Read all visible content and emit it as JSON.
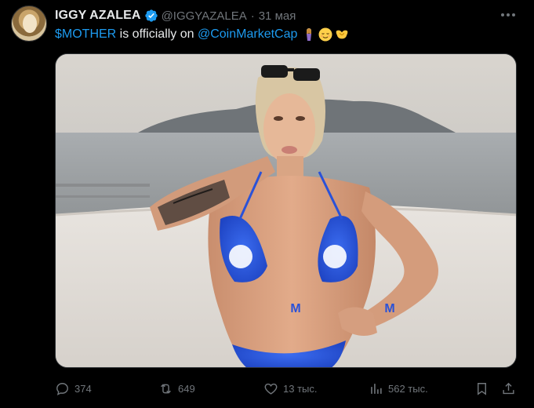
{
  "tweet": {
    "author_name": "IGGY AZALEA",
    "handle": "@IGGYAZALEA",
    "separator": "·",
    "date": "31 мая",
    "text": {
      "cashtag": "$MOTHER",
      "middle": " is officially on ",
      "mention": "@CoinMarketCap"
    },
    "emojis": [
      "woman-icon",
      "relieved-face-icon",
      "heart-hands-icon"
    ]
  },
  "media": {
    "logo_letter": "M"
  },
  "actions": {
    "replies": "374",
    "reposts": "649",
    "likes": "13 тыс.",
    "views": "562 тыс."
  },
  "colors": {
    "background": "#000000",
    "text": "#e7e9ea",
    "secondary": "#71767b",
    "link": "#1d9bf0",
    "verified": "#1d9bf0"
  }
}
